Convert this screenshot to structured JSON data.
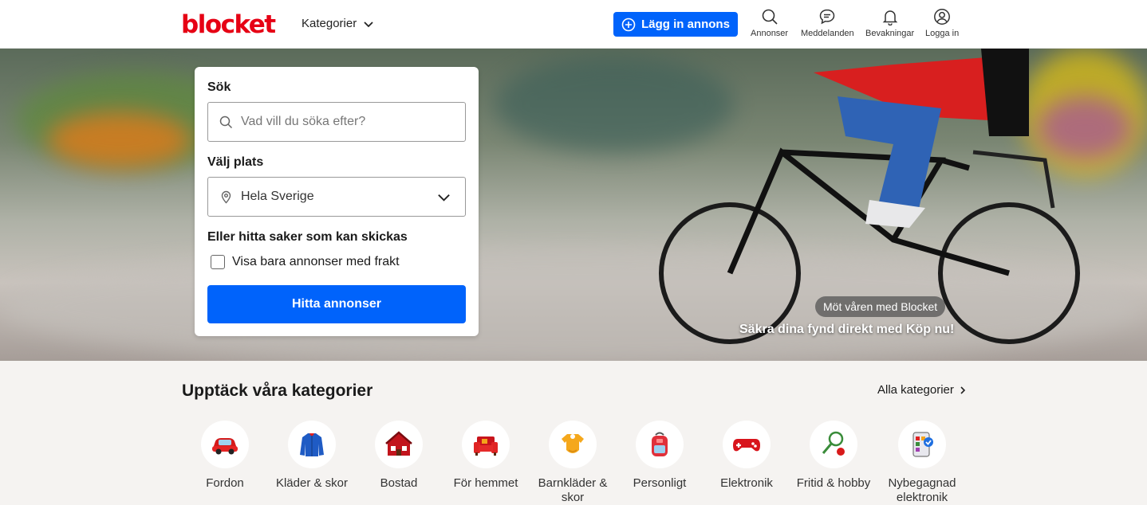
{
  "header": {
    "logo": "blocket",
    "categories_label": "Kategorier",
    "post_button": "Lägg in annons",
    "nav": [
      {
        "label": "Annonser",
        "icon": "search-icon"
      },
      {
        "label": "Meddelanden",
        "icon": "chat-icon"
      },
      {
        "label": "Bevakningar",
        "icon": "bell-icon"
      },
      {
        "label": "Logga in",
        "icon": "user-icon"
      }
    ]
  },
  "search": {
    "title": "Sök",
    "placeholder": "Vad vill du söka efter?",
    "place_label": "Välj plats",
    "place_value": "Hela Sverige",
    "shipping_title": "Eller hitta saker som kan skickas",
    "shipping_checkbox": "Visa bara annonser med frakt",
    "submit": "Hitta annonser"
  },
  "promo": {
    "tag": "Möt våren med Blocket",
    "text": "Säkra dina fynd direkt med Köp nu!"
  },
  "categories": {
    "title": "Upptäck våra kategorier",
    "all_label": "Alla kategorier",
    "items": [
      {
        "label": "Fordon",
        "icon": "car-icon"
      },
      {
        "label": "Kläder & skor",
        "icon": "jacket-icon"
      },
      {
        "label": "Bostad",
        "icon": "house-icon"
      },
      {
        "label": "För hemmet",
        "icon": "sofa-icon"
      },
      {
        "label": "Barnkläder & skor",
        "icon": "baby-clothes-icon"
      },
      {
        "label": "Personligt",
        "icon": "backpack-icon"
      },
      {
        "label": "Elektronik",
        "icon": "gamepad-icon"
      },
      {
        "label": "Fritid & hobby",
        "icon": "tennis-icon"
      },
      {
        "label": "Nybegagnad elektronik",
        "icon": "phone-icon"
      }
    ]
  },
  "colors": {
    "brand": "#e60014",
    "primary": "#0063fb"
  }
}
